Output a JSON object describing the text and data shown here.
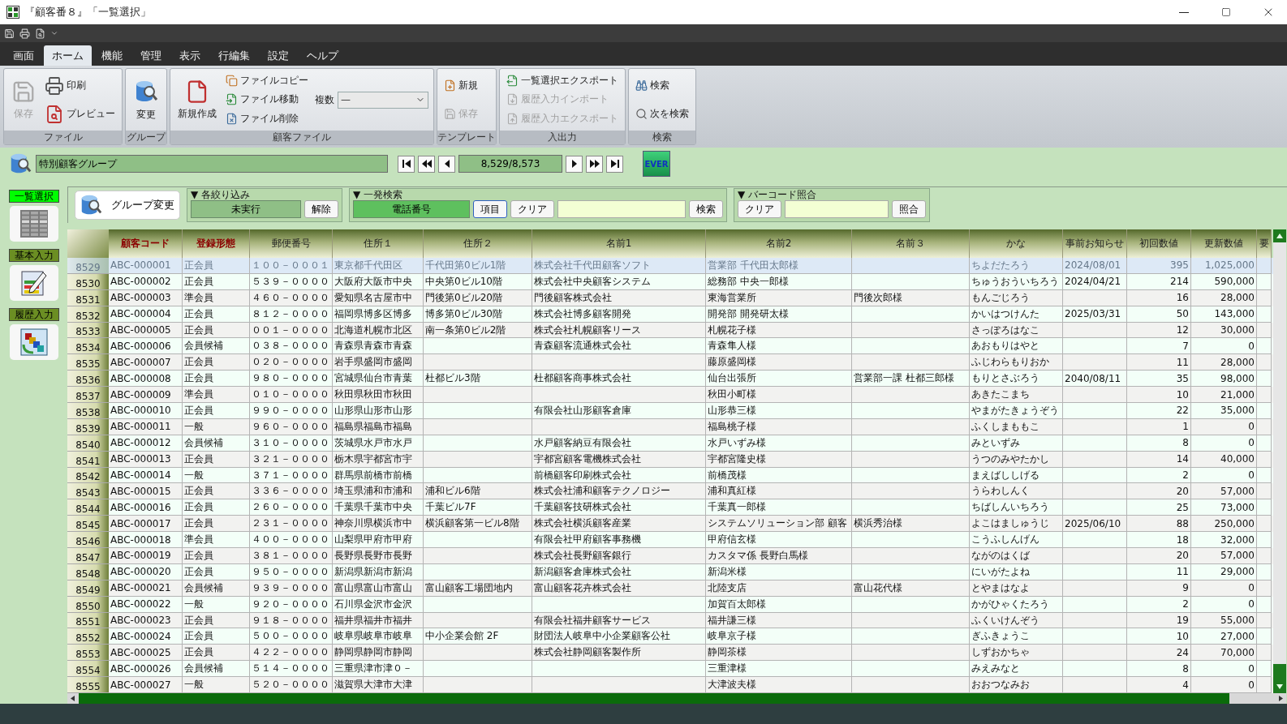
{
  "window": {
    "title": "『顧客番８』「一覧選択」"
  },
  "menu_tabs": [
    {
      "label": "画面",
      "selected": false
    },
    {
      "label": "ホーム",
      "selected": true
    },
    {
      "label": "機能",
      "selected": false
    },
    {
      "label": "管理",
      "selected": false
    },
    {
      "label": "表示",
      "selected": false
    },
    {
      "label": "行編集",
      "selected": false
    },
    {
      "label": "設定",
      "selected": false
    },
    {
      "label": "ヘルプ",
      "selected": false
    }
  ],
  "ribbon_groups": [
    {
      "title": "ファイル",
      "items": [
        {
          "kind": "large",
          "label": "保存",
          "disabled": true
        },
        {
          "kind": "medium",
          "label": "印刷",
          "disabled": false
        },
        {
          "kind": "medium",
          "label": "プレビュー",
          "disabled": false
        }
      ]
    },
    {
      "title": "グループ",
      "items": [
        {
          "kind": "large",
          "label": "変更",
          "disabled": false
        }
      ]
    },
    {
      "title": "顧客ファイル",
      "items": [
        {
          "kind": "large",
          "label": "新規作成",
          "disabled": false
        },
        {
          "kind": "small",
          "label": "ファイルコピー",
          "disabled": false
        },
        {
          "kind": "small",
          "label": "ファイル移動",
          "disabled": false
        },
        {
          "kind": "small",
          "label": "ファイル削除",
          "disabled": false
        },
        {
          "kind": "select",
          "label": "複数",
          "value": "—",
          "disabled": false
        }
      ]
    },
    {
      "title": "テンプレート",
      "items": [
        {
          "kind": "small",
          "label": "新規",
          "disabled": false
        },
        {
          "kind": "small",
          "label": "保存",
          "disabled": true
        }
      ]
    },
    {
      "title": "入出力",
      "items": [
        {
          "kind": "small",
          "label": "一覧選択エクスポート",
          "disabled": false
        },
        {
          "kind": "small",
          "label": "履歴入力インポート",
          "disabled": true
        },
        {
          "kind": "small",
          "label": "履歴入力エクスポート",
          "disabled": true
        }
      ]
    },
    {
      "title": "検索",
      "items": [
        {
          "kind": "small",
          "label": "検索",
          "disabled": false
        },
        {
          "kind": "small",
          "label": "次を検索",
          "disabled": false
        }
      ]
    }
  ],
  "group_bar": {
    "group": "特別顧客グループ",
    "counter": "8,529/8,573",
    "ever": "EVER"
  },
  "sidebar": [
    {
      "label": "一覧選択",
      "selected": true
    },
    {
      "label": "基本入力",
      "selected": false
    },
    {
      "label": "履歴入力",
      "selected": false
    }
  ],
  "filters": {
    "group_change": "グループ変更",
    "narrowing": {
      "title": "▼ 各絞り込み",
      "status": "未実行",
      "clear": "解除"
    },
    "quick_search": {
      "title": "▼ 一発検索",
      "field": "電話番号",
      "item": "項目",
      "clear": "クリア",
      "search": "検索"
    },
    "barcode": {
      "title": "▼ バーコード照合",
      "clear": "クリア",
      "match": "照合"
    }
  },
  "table": {
    "columns": [
      {
        "label": "顧客コード",
        "kind": "key"
      },
      {
        "label": "登録形態",
        "kind": "key"
      },
      {
        "label": "郵便番号",
        "kind": "text"
      },
      {
        "label": "住所１",
        "kind": "text"
      },
      {
        "label": "住所２",
        "kind": "text"
      },
      {
        "label": "名前1",
        "kind": "text"
      },
      {
        "label": "名前2",
        "kind": "text"
      },
      {
        "label": "名前３",
        "kind": "text"
      },
      {
        "label": "かな",
        "kind": "text"
      },
      {
        "label": "事前お知らせ",
        "kind": "text"
      },
      {
        "label": "初回数値",
        "kind": "number"
      },
      {
        "label": "更新数値",
        "kind": "number"
      },
      {
        "label": "要",
        "kind": "text"
      }
    ],
    "rows": [
      {
        "num": "8529",
        "selected": true,
        "cells": [
          "ABC-000001",
          "正会員",
          "１００－０００１",
          "東京都千代田区",
          "千代田第0ビル1階",
          "株式会社千代田顧客ソフト",
          "営業部 千代田太郎様",
          null,
          "ちよだたろう",
          "2024/08/01",
          "395",
          "1,025,000"
        ]
      },
      {
        "num": "8530",
        "selected": false,
        "cells": [
          "ABC-000002",
          "正会員",
          "５３９－００００",
          "大阪府大阪市中央",
          "中央第0ビル10階",
          "株式会社中央顧客システム",
          "総務部 中央一郎様",
          null,
          "ちゅうおういちろう",
          "2024/04/21",
          "214",
          "590,000"
        ]
      },
      {
        "num": "8531",
        "selected": false,
        "cells": [
          "ABC-000003",
          "準会員",
          "４６０－００００",
          "愛知県名古屋市中",
          "門後第0ビル20階",
          "門後顧客株式会社",
          "東海営業所",
          "門後次郎様",
          "もんごじろう",
          null,
          "16",
          "28,000"
        ]
      },
      {
        "num": "8532",
        "selected": false,
        "cells": [
          "ABC-000004",
          "正会員",
          "８１２－００００",
          "福岡県博多区博多",
          "博多第0ビル30階",
          "株式会社博多顧客開発",
          "開発部 開発研太様",
          null,
          "かいはつけんた",
          "2025/03/31",
          "50",
          "143,000"
        ]
      },
      {
        "num": "8533",
        "selected": false,
        "cells": [
          "ABC-000005",
          "正会員",
          "００１－００００",
          "北海道札幌市北区",
          "南一条第0ビル2階",
          "株式会社札幌顧客リース",
          "札幌花子様",
          null,
          "さっぽろはなこ",
          null,
          "12",
          "30,000"
        ]
      },
      {
        "num": "8534",
        "selected": false,
        "cells": [
          "ABC-000006",
          "会員候補",
          "０３８－００００",
          "青森県青森市青森",
          null,
          "青森顧客流通株式会社",
          "青森隼人様",
          null,
          "あおもりはやと",
          null,
          "7",
          "0"
        ]
      },
      {
        "num": "8535",
        "selected": false,
        "cells": [
          "ABC-000007",
          "正会員",
          "０２０－００００",
          "岩手県盛岡市盛岡",
          null,
          null,
          "藤原盛岡様",
          null,
          "ふじわらもりおか",
          null,
          "11",
          "28,000"
        ]
      },
      {
        "num": "8536",
        "selected": false,
        "cells": [
          "ABC-000008",
          "正会員",
          "９８０－００００",
          "宮城県仙台市青葉",
          "杜都ビル3階",
          "杜都顧客商事株式会社",
          "仙台出張所",
          "営業部一課 杜都三郎様",
          "もりとさぶろう",
          "2040/08/11",
          "35",
          "98,000"
        ]
      },
      {
        "num": "8537",
        "selected": false,
        "cells": [
          "ABC-000009",
          "準会員",
          "０１０－００００",
          "秋田県秋田市秋田",
          null,
          null,
          "秋田小町様",
          null,
          "あきたこまち",
          null,
          "10",
          "21,000"
        ]
      },
      {
        "num": "8538",
        "selected": false,
        "cells": [
          "ABC-000010",
          "正会員",
          "９９０－００００",
          "山形県山形市山形",
          null,
          "有限会社山形顧客倉庫",
          "山形恭三様",
          null,
          "やまがたきょうぞう",
          null,
          "22",
          "35,000"
        ]
      },
      {
        "num": "8539",
        "selected": false,
        "cells": [
          "ABC-000011",
          "一般",
          "９６０－００００",
          "福島県福島市福島",
          null,
          null,
          "福島桃子様",
          null,
          "ふくしまももこ",
          null,
          "1",
          "0"
        ]
      },
      {
        "num": "8540",
        "selected": false,
        "cells": [
          "ABC-000012",
          "会員候補",
          "３１０－００００",
          "茨城県水戸市水戸",
          null,
          "水戸顧客納豆有限会社",
          "水戸いずみ様",
          null,
          "みといずみ",
          null,
          "8",
          "0"
        ]
      },
      {
        "num": "8541",
        "selected": false,
        "cells": [
          "ABC-000013",
          "正会員",
          "３２１－００００",
          "栃木県宇都宮市宇",
          null,
          "宇都宮顧客電機株式会社",
          "宇都宮隆史様",
          null,
          "うつのみやたかし",
          null,
          "14",
          "40,000"
        ]
      },
      {
        "num": "8542",
        "selected": false,
        "cells": [
          "ABC-000014",
          "一般",
          "３７１－００００",
          "群馬県前橋市前橋",
          null,
          "前橋顧客印刷株式会社",
          "前橋茂様",
          null,
          "まえばししげる",
          null,
          "2",
          "0"
        ]
      },
      {
        "num": "8543",
        "selected": false,
        "cells": [
          "ABC-000015",
          "正会員",
          "３３６－００００",
          "埼玉県浦和市浦和",
          "浦和ビル6階",
          "株式会社浦和顧客テクノロジー",
          "浦和真紅様",
          null,
          "うらわしんく",
          null,
          "20",
          "57,000"
        ]
      },
      {
        "num": "8544",
        "selected": false,
        "cells": [
          "ABC-000016",
          "正会員",
          "２６０－００００",
          "千葉県千葉市中央",
          "千葉ビル7F",
          "千葉顧客技研株式会社",
          "千葉真一郎様",
          null,
          "ちばしんいちろう",
          null,
          "25",
          "73,000"
        ]
      },
      {
        "num": "8545",
        "selected": false,
        "cells": [
          "ABC-000017",
          "正会員",
          "２３１－００００",
          "神奈川県横浜市中",
          "横浜顧客第一ビル8階",
          "株式会社横浜顧客産業",
          "システムソリューション部 顧客",
          "横浜秀治様",
          "よこはましゅうじ",
          "2025/06/10",
          "88",
          "250,000"
        ]
      },
      {
        "num": "8546",
        "selected": false,
        "cells": [
          "ABC-000018",
          "準会員",
          "４００－００００",
          "山梨県甲府市甲府",
          null,
          "有限会社甲府顧客事務機",
          "甲府信玄様",
          null,
          "こうふしんげん",
          null,
          "18",
          "32,000"
        ]
      },
      {
        "num": "8547",
        "selected": false,
        "cells": [
          "ABC-000019",
          "正会員",
          "３８１－００００",
          "長野県長野市長野",
          null,
          "株式会社長野顧客銀行",
          "カスタマ係 長野白馬様",
          null,
          "ながのはくば",
          null,
          "20",
          "57,000"
        ]
      },
      {
        "num": "8548",
        "selected": false,
        "cells": [
          "ABC-000020",
          "正会員",
          "９５０－００００",
          "新潟県新潟市新潟",
          null,
          "新潟顧客倉庫株式会社",
          "新潟米様",
          null,
          "にいがたよね",
          null,
          "11",
          "29,000"
        ]
      },
      {
        "num": "8549",
        "selected": false,
        "cells": [
          "ABC-000021",
          "会員候補",
          "９３９－００００",
          "富山県富山市富山",
          "富山顧客工場団地内",
          "富山顧客花卉株式会社",
          "北陸支店",
          "富山花代様",
          "とやまはなよ",
          null,
          "9",
          "0"
        ]
      },
      {
        "num": "8550",
        "selected": false,
        "cells": [
          "ABC-000022",
          "一般",
          "９２０－００００",
          "石川県金沢市金沢",
          null,
          null,
          "加賀百太郎様",
          null,
          "かがひゃくたろう",
          null,
          "2",
          "0"
        ]
      },
      {
        "num": "8551",
        "selected": false,
        "cells": [
          "ABC-000023",
          "正会員",
          "９１８－００００",
          "福井県福井市福井",
          null,
          "有限会社福井顧客サービス",
          "福井謙三様",
          null,
          "ふくいけんぞう",
          null,
          "19",
          "55,000"
        ]
      },
      {
        "num": "8552",
        "selected": false,
        "cells": [
          "ABC-000024",
          "正会員",
          "５００－００００",
          "岐阜県岐阜市岐阜",
          "中小企業会館 2F",
          "財団法人岐阜中小企業顧客公社",
          "岐阜京子様",
          null,
          "ぎふきょうこ",
          null,
          "10",
          "27,000"
        ]
      },
      {
        "num": "8553",
        "selected": false,
        "cells": [
          "ABC-000025",
          "正会員",
          "４２２－００００",
          "静岡県静岡市静岡",
          null,
          "株式会社静岡顧客製作所",
          "静岡茶様",
          null,
          "しずおかちゃ",
          null,
          "24",
          "70,000"
        ]
      },
      {
        "num": "8554",
        "selected": false,
        "cells": [
          "ABC-000026",
          "会員候補",
          "５１４－００００",
          "三重県津市津０－",
          null,
          null,
          "三重津様",
          null,
          "みえみなと",
          null,
          "8",
          "0"
        ]
      },
      {
        "num": "8555",
        "selected": false,
        "cells": [
          "ABC-000027",
          "一般",
          "５２０－００００",
          "滋賀県大津市大津",
          null,
          null,
          "大津波夫様",
          null,
          "おおつなみお",
          null,
          "4",
          "0"
        ]
      }
    ]
  }
}
